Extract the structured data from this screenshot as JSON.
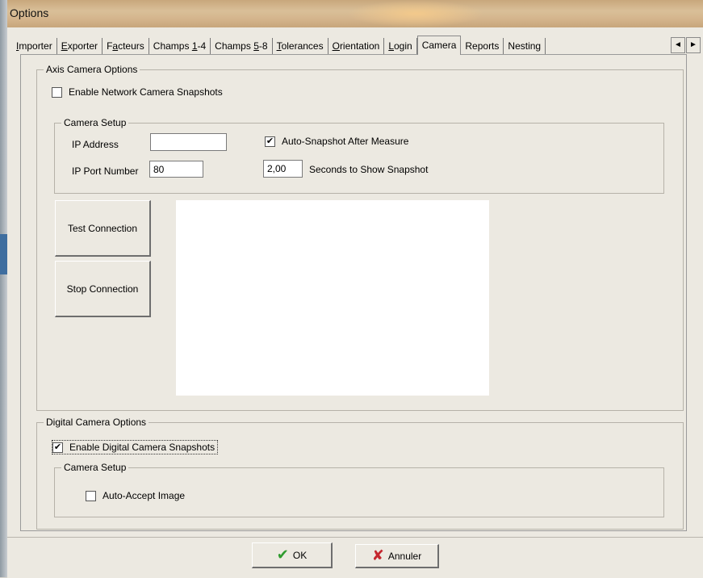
{
  "window": {
    "title": "Options"
  },
  "tabs": [
    {
      "pre": "",
      "u": "I",
      "post": "mporter"
    },
    {
      "pre": "",
      "u": "E",
      "post": "xporter"
    },
    {
      "pre": "F",
      "u": "a",
      "post": "cteurs"
    },
    {
      "pre": "Champs ",
      "u": "1",
      "post": "-4"
    },
    {
      "pre": "Champs ",
      "u": "5",
      "post": "-8"
    },
    {
      "pre": "",
      "u": "T",
      "post": "olerances"
    },
    {
      "pre": "",
      "u": "O",
      "post": "rientation"
    },
    {
      "pre": "",
      "u": "L",
      "post": "ogin"
    },
    {
      "pre": "Camera",
      "u": "",
      "post": ""
    },
    {
      "pre": "Reports",
      "u": "",
      "post": ""
    },
    {
      "pre": "Nesting",
      "u": "",
      "post": ""
    }
  ],
  "tab_scroll": {
    "left": "◄",
    "right": "►"
  },
  "axis": {
    "title": "Axis Camera Options",
    "enable_label": "Enable Network Camera Snapshots",
    "enable_checked": "",
    "setup_title": "Camera Setup",
    "ip_label": "IP Address",
    "ip_value": "",
    "port_label": "IP Port Number",
    "port_value": "80",
    "auto_label": "Auto-Snapshot After Measure",
    "auto_checked": "✔",
    "seconds_value": "2,00",
    "seconds_label": "Seconds to Show Snapshot",
    "test_label": "Test Connection",
    "stop_label": "Stop Connection"
  },
  "digital": {
    "title": "Digital Camera Options",
    "enable_label": "Enable Digital Camera Snapshots",
    "enable_checked": "✔",
    "setup_title": "Camera Setup",
    "accept_label": "Auto-Accept Image",
    "accept_checked": ""
  },
  "buttons": {
    "ok": "OK",
    "cancel": "Annuler"
  },
  "colors": {
    "ok_icon": "#2e9b2e",
    "cancel_icon": "#c4262e"
  }
}
